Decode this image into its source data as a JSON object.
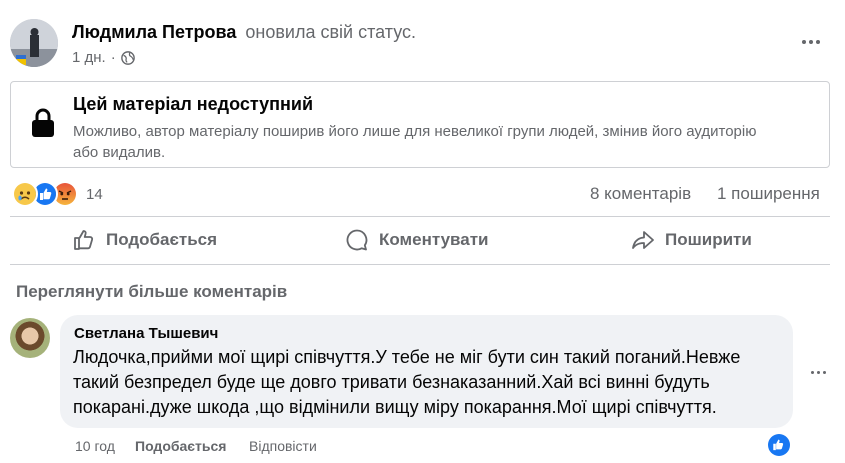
{
  "post": {
    "author": "Людмила Петрова",
    "action": "оновила свій статус.",
    "time": "1 дн.",
    "audience_icon": "globe-icon",
    "more_icon": "more-dots-icon"
  },
  "unavailable": {
    "title": "Цей матеріал недоступний",
    "text": "Можливо, автор матеріалу поширив його лише для невеликої групи людей, змінив його аудиторію або видалив.",
    "icon": "lock-icon"
  },
  "stats": {
    "reaction_icons": [
      "sad-reaction-icon",
      "like-reaction-icon",
      "angry-reaction-icon"
    ],
    "reaction_count": "14",
    "comments": "8 коментарів",
    "shares": "1 поширення"
  },
  "actions": {
    "like": "Подобається",
    "comment": "Коментувати",
    "share": "Поширити"
  },
  "view_more_comments": "Переглянути більше коментарів",
  "comment": {
    "author": "Светлана Тышевич",
    "text": "Людочка,прийми мої щирі співчуття.У тебе не міг бути син такий поганий.Невже такий безпредел буде ще довго тривати безнаказанний.Хай всі винні будуть покарані.дуже шкода ,що відмінили вищу міру покарання.Мої щирі співчуття.",
    "time": "10 год",
    "like": "Подобається",
    "reply": "Відповісти",
    "reaction_icon": "like-reaction-icon"
  },
  "colors": {
    "text_primary": "#050505",
    "text_secondary": "#65676b",
    "divider": "#ced0d4",
    "bubble": "#f0f2f5",
    "like_blue": "#1877f2"
  }
}
